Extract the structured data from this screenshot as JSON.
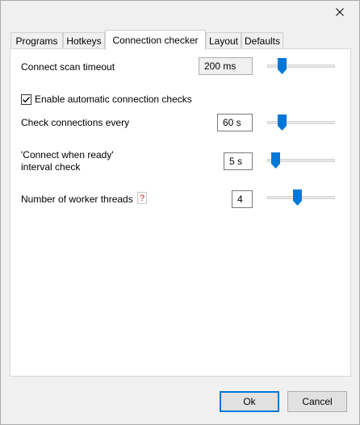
{
  "tabs": [
    {
      "label": "Programs",
      "active": false
    },
    {
      "label": "Hotkeys",
      "active": false
    },
    {
      "label": "Connection checker",
      "active": true
    },
    {
      "label": "Layout",
      "active": false
    },
    {
      "label": "Defaults",
      "active": false
    }
  ],
  "settings": {
    "scan_timeout": {
      "label": "Connect scan timeout",
      "value": "200 ms",
      "slider_fraction": 0.12
    },
    "auto_checks": {
      "label": "Enable automatic connection checks",
      "checked": true
    },
    "check_every": {
      "label": "Check connections every",
      "value": "60 s",
      "slider_fraction": 0.12
    },
    "connect_ready": {
      "label_line1": "'Connect when ready'",
      "label_line2": "interval check",
      "value": "5 s",
      "slider_fraction": 0.0
    },
    "worker_threads": {
      "label": "Number of worker threads",
      "help": "?",
      "value": "4",
      "slider_fraction": 0.4
    }
  },
  "buttons": {
    "ok": "Ok",
    "cancel": "Cancel"
  },
  "colors": {
    "accent": "#0078d7"
  },
  "icons": {
    "close": "close-icon",
    "help": "help-icon",
    "check": "checkmark-icon"
  }
}
